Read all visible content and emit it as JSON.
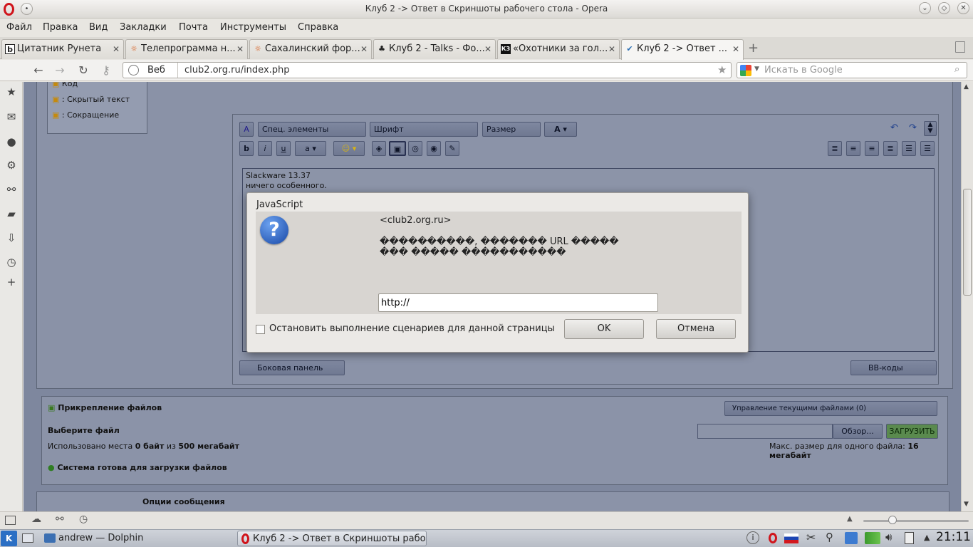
{
  "window": {
    "title": "Клуб 2 -> Ответ в Скриншоты рабочего стола - Opera"
  },
  "menu": [
    "Файл",
    "Правка",
    "Вид",
    "Закладки",
    "Почта",
    "Инструменты",
    "Справка"
  ],
  "tabs": [
    {
      "label": "Цитатник Рунета",
      "icon": "b"
    },
    {
      "label": "Телепрограмма н...",
      "icon": "☼"
    },
    {
      "label": "Сахалинский фор...",
      "icon": "☼"
    },
    {
      "label": "Клуб 2 - Talks - Фо...",
      "icon": "♣"
    },
    {
      "label": "«Охотники за гол...",
      "icon": "КЗ"
    },
    {
      "label": "Клуб 2 -> Ответ ...",
      "icon": "✔"
    }
  ],
  "nav": {
    "web_label": "Веб",
    "url": "club2.org.ru/index.php",
    "search_placeholder": "Искать в Google"
  },
  "page": {
    "left_items": [
      "Код",
      ": Скрытый текст",
      ": Сокращение"
    ],
    "toolbar_selects": {
      "special": "Спец. элементы",
      "font": "Шрифт",
      "size": "Размер"
    },
    "editor_text": [
      "Slackware 13.37",
      "ничего особенного."
    ],
    "side_panel_btn": "Боковая панель",
    "bbcodes_btn": "BB-коды",
    "attach": {
      "title": "Прикрепление файлов",
      "manage": "Управление текущими файлами (0)",
      "choose": "Выберите файл",
      "used_prefix": "Использовано места",
      "used_value": "0 байт",
      "used_mid": "из",
      "used_total": "500 мегабайт",
      "browse": "Обзор...",
      "upload": "ЗАГРУЗИТЬ",
      "max_prefix": "Макс. размер для одного файла:",
      "max_value": "16 мегабайт",
      "ready": "Система готова для загрузки файлов"
    },
    "options_title": "Опции сообщения"
  },
  "dialog": {
    "title": "JavaScript",
    "origin": "<club2.org.ru>",
    "message_line1": "����������, ������� URL �����",
    "message_line2": "��� ����� �����������",
    "input_value": "http://",
    "checkbox_label": "Остановить выполнение сценариев для данной страницы",
    "ok": "OK",
    "cancel": "Отмена"
  },
  "taskbar": {
    "dolphin": "andrew — Dolphin",
    "opera": "Клуб 2 -> Ответ в Скриншоты рабо",
    "clock": "21:11"
  }
}
